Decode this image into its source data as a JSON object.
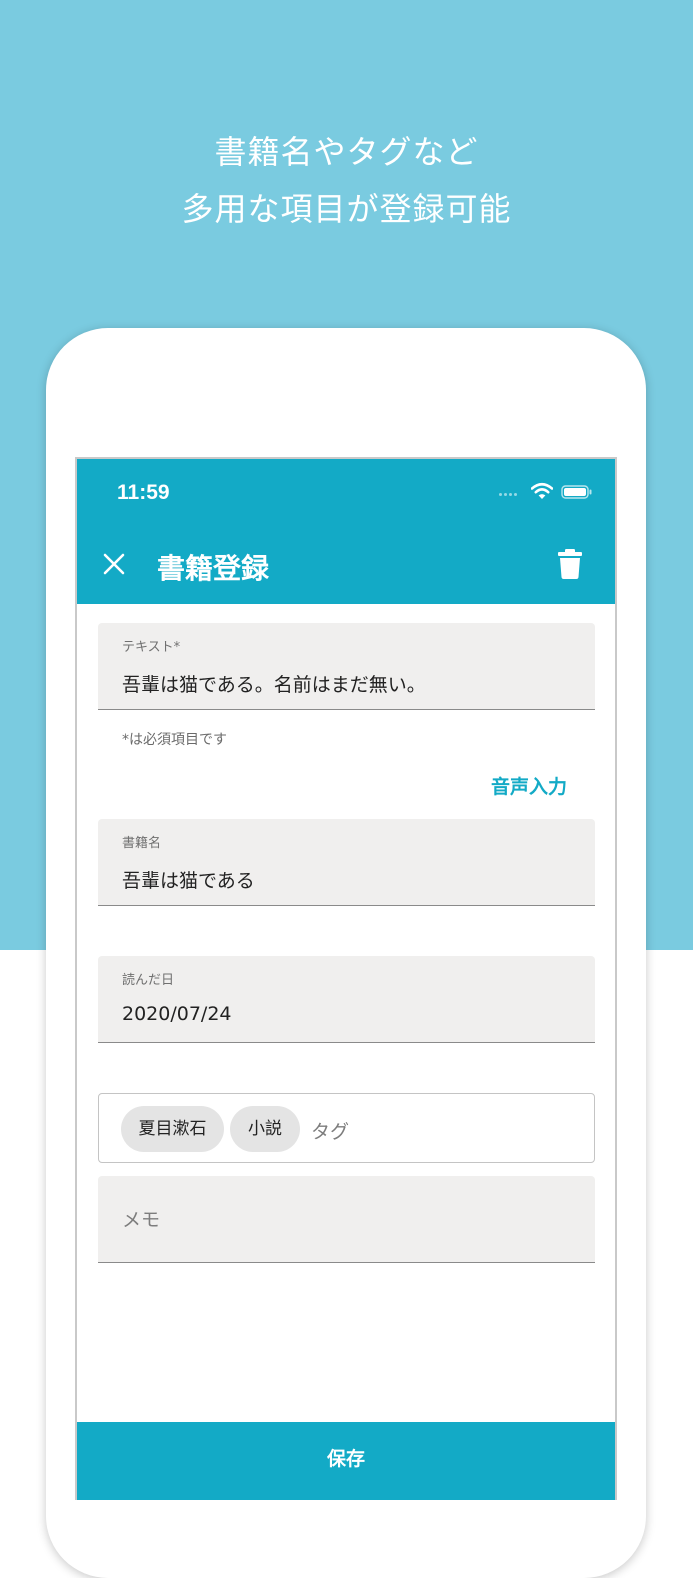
{
  "promo": {
    "headline_line1": "書籍名やタグなど",
    "headline_line2": "多用な項目が登録可能"
  },
  "status_bar": {
    "time": "11:59"
  },
  "app_bar": {
    "title": "書籍登録",
    "close_icon": "close-icon",
    "delete_icon": "trash-icon"
  },
  "form": {
    "text_field": {
      "label": "テキスト*",
      "value": "吾輩は猫である。名前はまだ無い。"
    },
    "helper": "*は必須項目です",
    "voice_input_label": "音声入力",
    "book_title_field": {
      "label": "書籍名",
      "value": "吾輩は猫である"
    },
    "read_date_field": {
      "label": "読んだ日",
      "value": "2020/07/24"
    },
    "tags": {
      "chips": [
        "夏目漱石",
        "小説"
      ],
      "placeholder": "タグ"
    },
    "memo_field": {
      "placeholder": "メモ"
    },
    "save_label": "保存"
  },
  "colors": {
    "promo_background": "#7acbe0",
    "app_bar": "#13aac6",
    "accent": "#13aac6",
    "field_background": "#f0efee"
  }
}
